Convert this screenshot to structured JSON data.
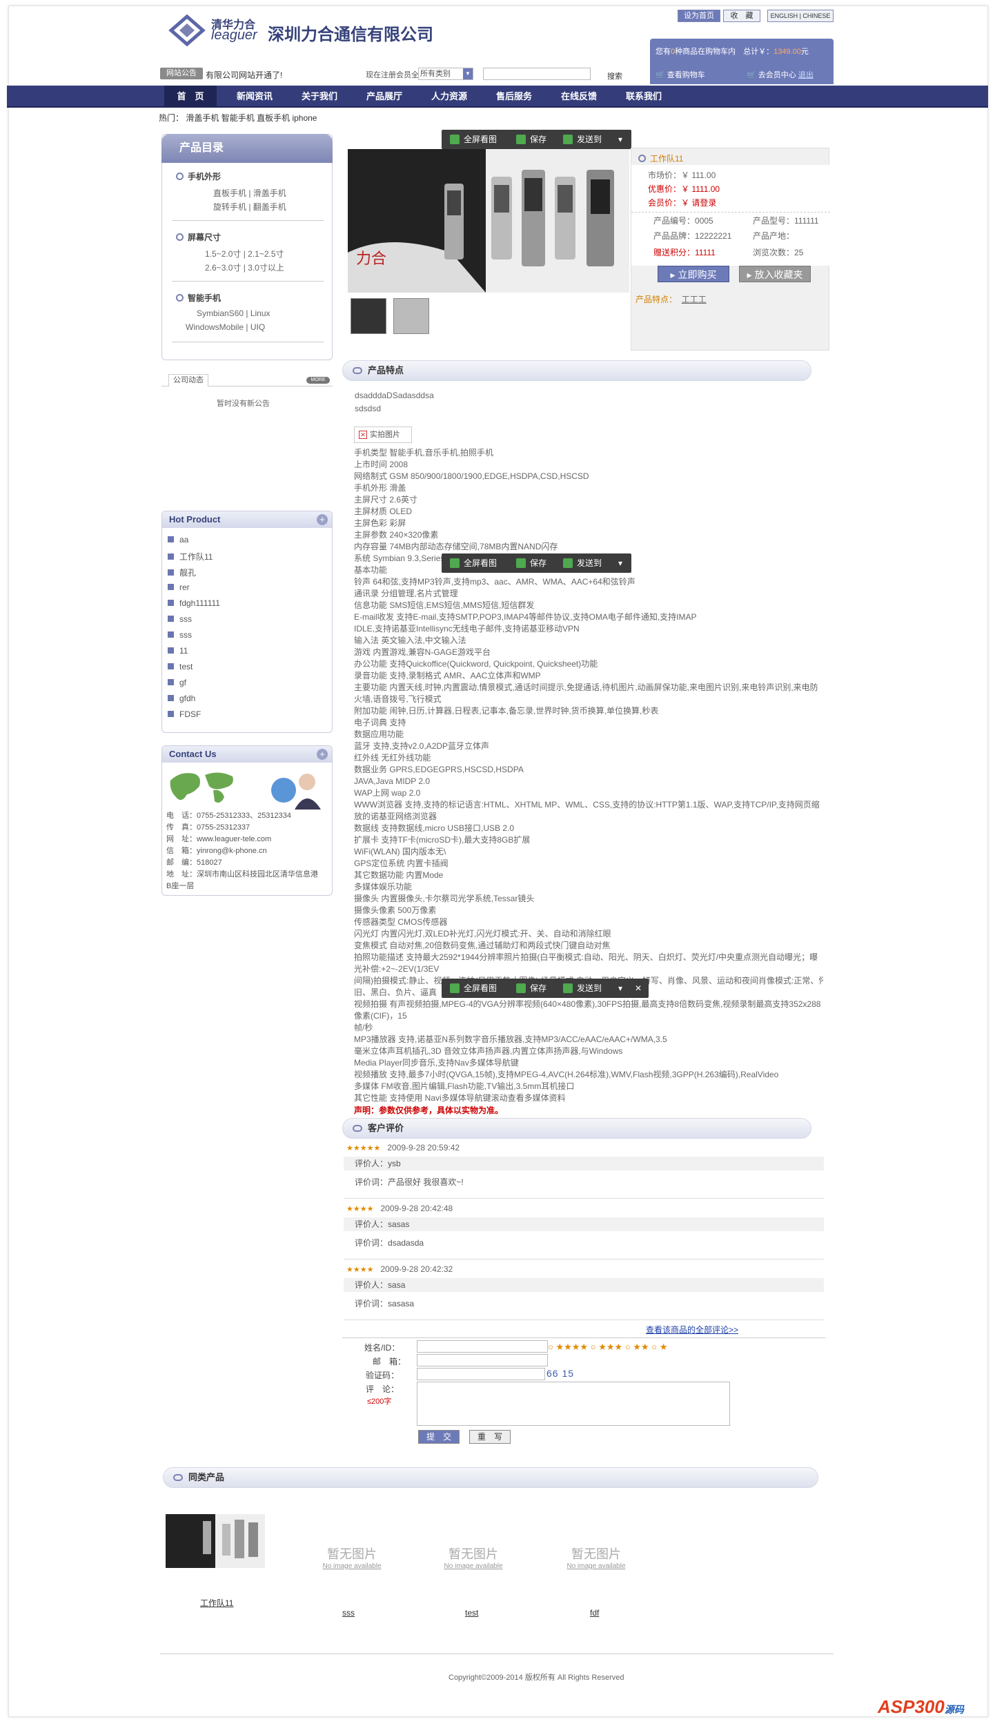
{
  "colors": {
    "nav": "#343d7a",
    "accent": "#6d7ab8",
    "price_red": "#cc0000",
    "stars": "#e08a00"
  },
  "header": {
    "logo_cn": "清华力合",
    "logo_en": "leaguer",
    "company": "深圳力合通信有限公司",
    "btn_home": "设为首页",
    "btn_fav": "收　藏",
    "btn_lang": "ENGLISH | CHINESE"
  },
  "cart": {
    "line1_prefix": "您有",
    "line1_count": "0",
    "line1_mid": "种商品在购物车内　总计￥：",
    "line1_total": "1349.00",
    "line1_suffix": "元",
    "view_cart": "查看购物车",
    "member": "去会员中心",
    "logout": "退出"
  },
  "notice": {
    "tag": "网站公告",
    "text": "有限公司网站开通了!",
    "reg_label": "现在注册会员全场",
    "select_value": "所有类别",
    "search_btn": "搜索"
  },
  "nav": [
    "首　页",
    "新闻资讯",
    "关于我们",
    "产品展厅",
    "人力资源",
    "售后服务",
    "在线反馈",
    "联系我们"
  ],
  "hot": {
    "label": "热门：",
    "items": [
      "滑盖手机",
      "智能手机",
      "直板手机",
      "iphone"
    ]
  },
  "catalog": {
    "title": "产品目录",
    "sections": [
      {
        "title": "手机外形",
        "lines": [
          "直板手机 | 滑盖手机",
          "旋转手机 | 翻盖手机"
        ]
      },
      {
        "title": "屏幕尺寸",
        "lines": [
          "1.5~2.0寸 | 2.1~2.5寸",
          "2.6~3.0寸 | 3.0寸以上"
        ]
      },
      {
        "title": "智能手机",
        "lines": [
          "SymbianS60 | Linux",
          "WindowsMobile | UIQ"
        ]
      }
    ]
  },
  "news": {
    "tab": "公司动态",
    "more": "MORE",
    "empty": "暂时没有新公告"
  },
  "hotproduct": {
    "title": "Hot Product",
    "items": [
      "aa",
      "工作队11",
      "靓孔",
      "rer",
      "fdgh111111",
      "sss",
      "sss",
      "11",
      "test",
      "gf",
      "gfdh",
      "FDSF"
    ]
  },
  "contact": {
    "title": "Contact Us",
    "lines": [
      "电　话：0755-25312333、25312334",
      "传　真：0755-25312337",
      "网　址：www.leaguer-tele.com",
      "信　箱：yinrong@k-phone.cn",
      "邮　编：518027",
      "地　址：深圳市南山区科技园北区清华信息港",
      "B座一层"
    ]
  },
  "toolbar": {
    "fullscreen": "全屏看图",
    "save": "保存",
    "send": "发送到"
  },
  "product": {
    "name": "工作队11",
    "market_price_label": "市场价：",
    "market_price": "￥ 111.00",
    "member_price_label": "优惠价：",
    "member_price": "￥ 1111.00",
    "vip_label": "会员价：",
    "vip": "￥ 请登录",
    "code_label": "产品编号：",
    "code": "0005",
    "model_label": "产品型号：",
    "model": "111111",
    "brand_label": "产品品牌：",
    "brand": "12222221",
    "origin_label": "产品产地：",
    "origin": "",
    "points_label": "赠送积分：",
    "points": "11111",
    "views_label": "浏览次数：",
    "views": "25",
    "buy_btn": "立即购买",
    "fav_btn": "放入收藏夹",
    "feature_label": "产品特点：",
    "feature": "工工工"
  },
  "features": {
    "title": "产品特点",
    "intro": [
      "dsadddaDSadasddsa",
      "sdsdsd"
    ],
    "photo_label": "实拍图片",
    "specs": [
      "手机类型  智能手机,音乐手机,拍照手机",
      "上市时间  2008",
      "网络制式  GSM 850/900/1800/1900,EDGE,HSDPA,CSD,HSCSD",
      "手机外形  滑盖",
      "主屏尺寸  2.6英寸",
      "主屏材质  OLED",
      "主屏色彩  彩屏",
      "主屏参数  240×320像素",
      "内存容量  74MB内部动态存储空间,78MB内置NAND闪存",
      "系统  Symbian 9.3,Series 60 3rd FP2",
      "基本功能",
      "铃声  64和弦,支持MP3铃声,支持mp3、aac、AMR、WMA、AAC+64和弦铃声",
      "通讯录  分组管理,名片式管理",
      "信息功能  SMS短信,EMS短信,MMS短信,短信群发",
      "E-mail收发  支持E-mail,支持SMTP,POP3,IMAP4等邮件协议,支持OMA电子邮件通知,支持IMAP",
      "IDLE,支持诺基亚Intellisync无线电子邮件,支持诺基亚移动VPN",
      "输入法  英文输入法,中文输入法",
      "游戏  内置游戏,兼容N-GAGE游戏平台",
      "办公功能  支持Quickoffice(Quickword, Quickpoint, Quicksheet)功能",
      "录音功能  支持,录制格式 AMR、AAC立体声和WMP",
      "主要功能  内置天线,时钟,内置震动,情景模式,通话时间提示,免提通话,待机图片,动画屏保功能,来电图片识别,来电铃声识别,来电防",
      "火墙,语音拨号,飞行模式",
      "附加功能  闹钟,日历,计算器,日程表,记事本,备忘录,世界时钟,货币换算,单位换算,秒表",
      "电子词典  支持",
      "数据应用功能",
      "蓝牙  支持,支持v2.0,A2DP蓝牙立体声",
      "红外线  无红外线功能",
      "数据业务  GPRS,EDGEGPRS,HSCSD,HSDPA",
      "JAVA,Java MIDP 2.0",
      "WAP上网  wap 2.0",
      "WWW浏览器  支持,支持的标记语言:HTML、XHTML MP、WML、CSS,支持的协议:HTTP第1.1版、WAP,支持TCP/IP,支持网页缩",
      "放的诺基亚网络浏览器",
      "数据线  支持数据线,micro USB接口,USB 2.0",
      "扩展卡  支持TF卡(microSD卡),最大支持8GB扩展",
      "WiFi(WLAN) 国内版本无\\",
      "GPS定位系统  内置卡插阀",
      "其它数据功能  内置Mode",
      "多媒体娱乐功能",
      "摄像头  内置摄像头,卡尔蔡司光学系统,Tessar镜头",
      "摄像头像素  500万像素",
      "传感器类型  CMOS传感器",
      "闪光灯  内置闪光灯,双LED补光灯,闪光灯模式:开、关、自动和消除红眼",
      "变焦模式  自动对焦,20倍数码变焦,通过辅助灯和两段式快门键自动对焦",
      "拍照功能描述  支持最大2592*1944分辨率照片拍摄(白平衡模式:自动、阳光、阴天、白炽灯、荧光灯/中央重点测光自动曝光；曝",
      "光补偿:+2~-2EV(1/3EV",
      "间隔)拍摄模式:静止、视频、连拍(只用于静止图像),场景模式:自动、用户定义、特写、肖像、风景、运动和夜间肖像模式:正常、怀",
      "旧、黑白、负片、逼真",
      "视频拍摄  有声视频拍摄,MPEG-4的VGA分辨率视频(640×480像素),30FPS拍摄,最高支持8倍数码变焦,视频录制最高支持352x288",
      "像素(CIF)，15",
      "帧/秒",
      "MP3播放器  支持,诺基亚N系列数字音乐播放器,支持MP3/ACC/eAAC/eAAC+/WMA,3.5",
      "毫米立体声耳机插孔,3D 音效立体声扬声器,内置立体声扬声器,与Windows",
      "Media Player同步音乐,支持Nav多媒体导航键",
      "视频播放  支持,最多7小时(QVGA,15帧),支持MPEG-4,AVC(H.264标准),WMV,Flash视频,3GPP(H.263编码),RealVideo",
      "多媒体  FM收音,图片编辑,Flash功能,TV输出,3.5mm耳机接口",
      "其它性能  支持使用  Navi多媒体导航键滚动查看多媒体资料"
    ],
    "disclaimer": "声明：参数仅供参考，具体以实物为准。"
  },
  "reviews": {
    "title": "客户评价",
    "reviewer_label": "评价人：",
    "content_label": "评价词：",
    "items": [
      {
        "stars": "★★★★★",
        "date": "2009-9-28 20:59:42",
        "reviewer": "ysb",
        "content": "产品很好 我很喜欢~!"
      },
      {
        "stars": "★★★★",
        "date": "2009-9-28 20:42:48",
        "reviewer": "sasas",
        "content": "dsadasda"
      },
      {
        "stars": "★★★★",
        "date": "2009-9-28 20:42:32",
        "reviewer": "sasa",
        "content": "sasasa"
      }
    ],
    "view_all": "查看该商品的全部评论>>"
  },
  "form": {
    "name_label": "姓名/ID：",
    "email_label": "邮　箱：",
    "code_label": "验证码：",
    "comment_label": "评　论：",
    "limit": "≤200字",
    "captcha": "66 15",
    "rating_opts": [
      "★★★",
      "★★",
      "★"
    ],
    "submit": "提　交",
    "reset": "重　写"
  },
  "related": {
    "title": "同类产品",
    "items": [
      {
        "name": "工作队11",
        "noimg": ""
      },
      {
        "name": "sss",
        "noimg": "暂无图片",
        "noimg_en": "No image available"
      },
      {
        "name": "test",
        "noimg": "暂无图片",
        "noimg_en": "No image available"
      },
      {
        "name": "fdf",
        "noimg": "暂无图片",
        "noimg_en": "No image available"
      }
    ]
  },
  "footer": {
    "copyright": "Copyright©2009-2014 版权所有  All Rights Reserved",
    "watermark": "ASP300",
    "watermark2": "源码"
  }
}
